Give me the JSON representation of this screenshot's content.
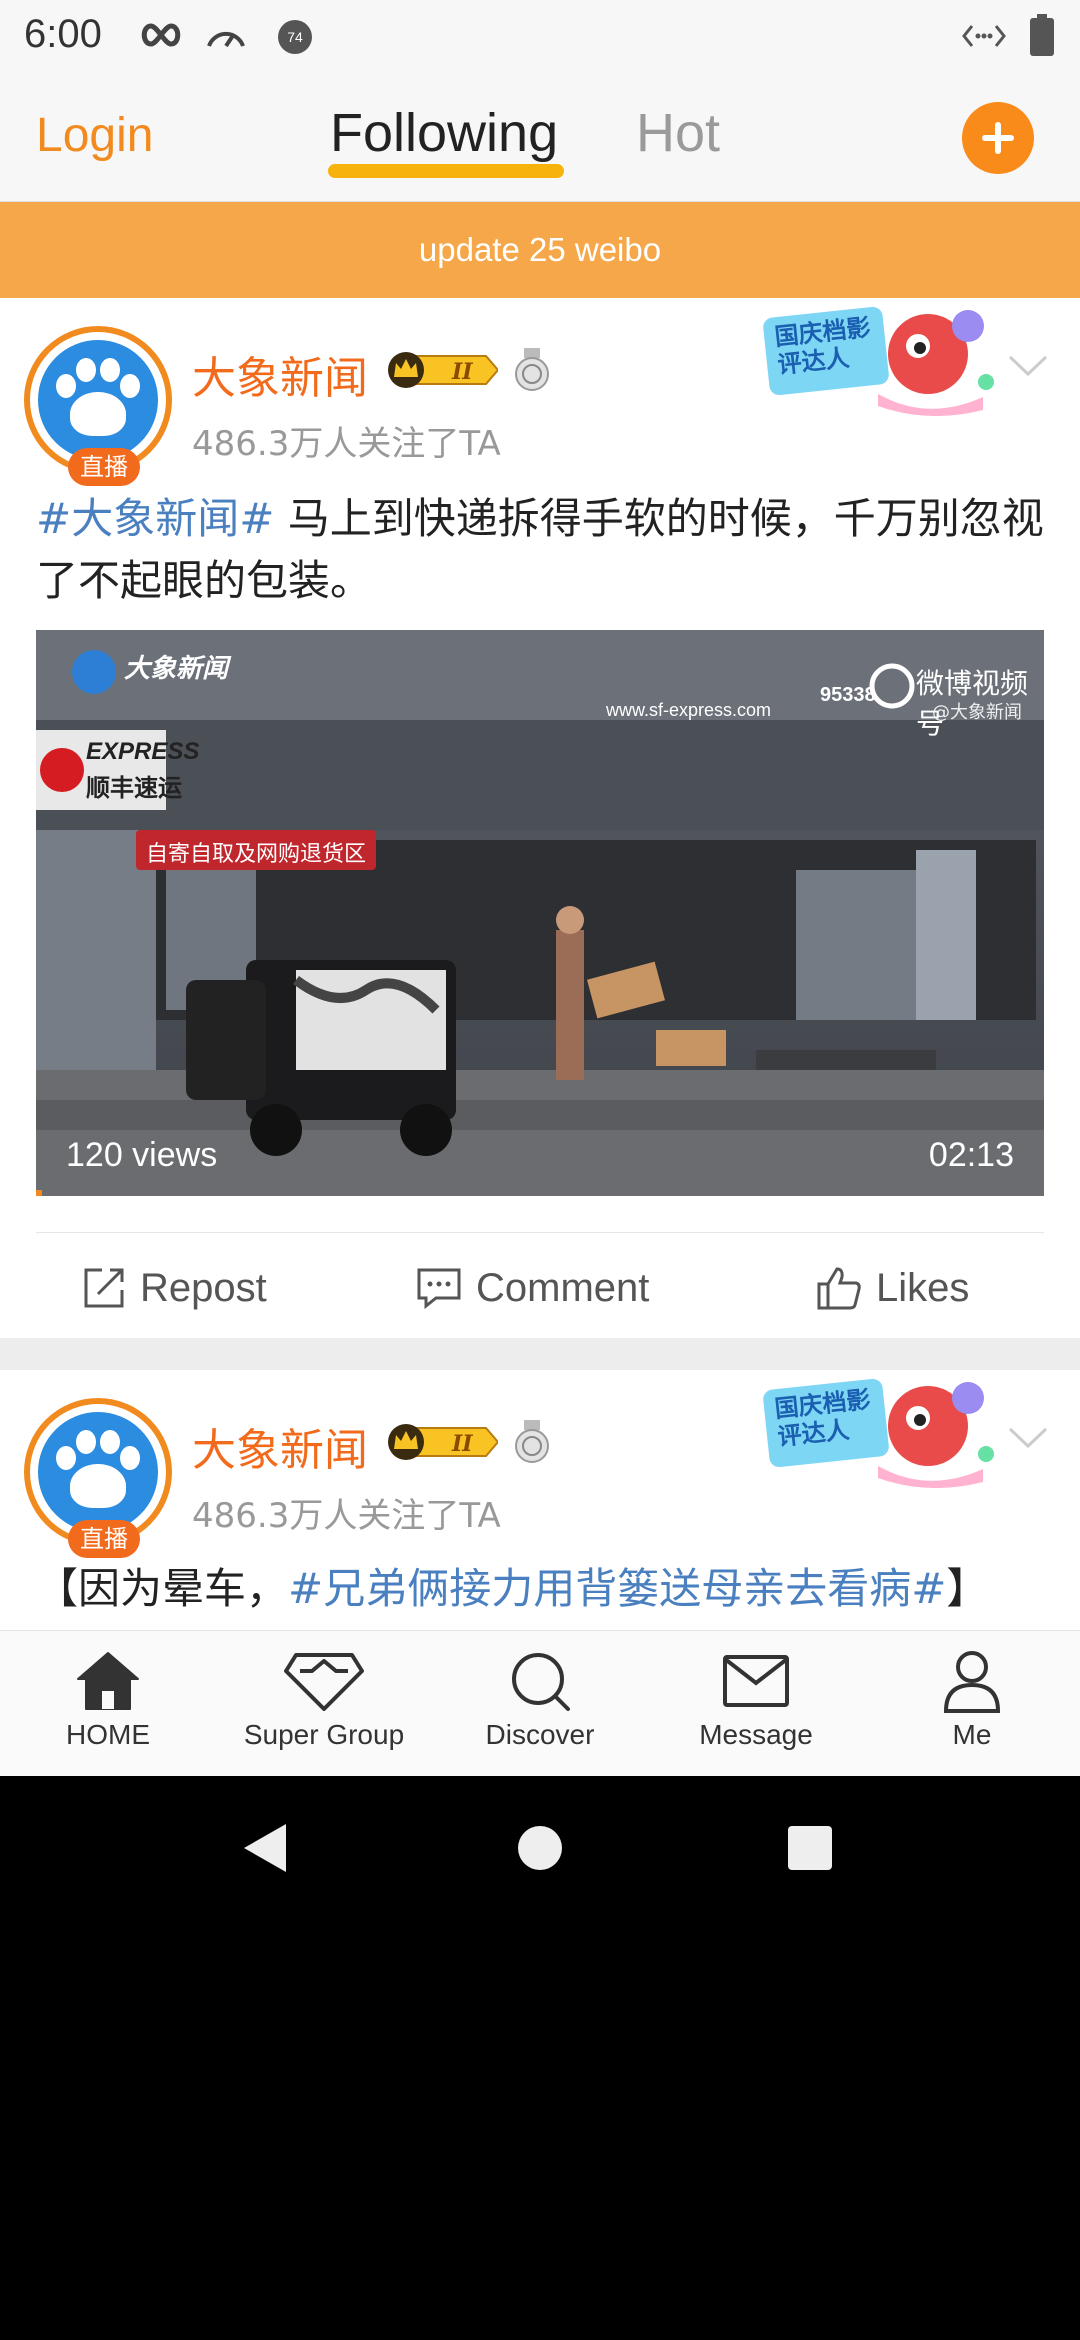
{
  "status_bar": {
    "time": "6:00",
    "icons": [
      "infinity-icon",
      "speedometer-icon",
      "notification-badge-icon",
      "data-transfer-icon",
      "battery-icon"
    ],
    "badge_count": "74"
  },
  "header": {
    "login_label": "Login",
    "tabs": [
      {
        "label": "Following",
        "active": true
      },
      {
        "label": "Hot",
        "active": false
      }
    ],
    "add_icon": "plus-icon",
    "accent_color": "#f88b19"
  },
  "update_banner": "update 25 weibo",
  "posts": [
    {
      "user_name": "大象新闻",
      "live_badge": "直播",
      "follow_count": "486.3万人关注了TA",
      "vip_level": "II",
      "sticker_text": "国庆档影评达人",
      "text_tag": "#大象新闻#",
      "text_body": " 马上到快递拆得手软的时候，千万别忽视了不起眼的包装。",
      "video": {
        "watermark_brand": "大象新闻",
        "watermark_platform": "微博视频号",
        "watermark_handle": "@大象新闻",
        "site_text": "www.sf-express.com",
        "store_logo_en": "EXPRESS",
        "store_logo_cn": "顺丰速运",
        "store_sign": "自寄自取及网购退货区",
        "phone_text": "95338",
        "views": "120 views",
        "duration": "02:13"
      },
      "actions": {
        "repost": "Repost",
        "comment": "Comment",
        "likes": "Likes"
      }
    },
    {
      "user_name": "大象新闻",
      "live_badge": "直播",
      "follow_count": "486.3万人关注了TA",
      "vip_level": "II",
      "sticker_text": "国庆档影评达人",
      "text_prefix": "【因为晕车，",
      "text_tag": "#兄弟俩接力用背篓送母亲去看病#",
      "text_suffix": "】"
    }
  ],
  "bottom_nav": [
    {
      "label": "HOME",
      "icon": "home-icon"
    },
    {
      "label": "Super Group",
      "icon": "diamond-icon"
    },
    {
      "label": "Discover",
      "icon": "search-icon"
    },
    {
      "label": "Message",
      "icon": "mail-icon"
    },
    {
      "label": "Me",
      "icon": "person-icon"
    }
  ],
  "system_nav": [
    "back-icon",
    "home-circle-icon",
    "recents-icon"
  ]
}
